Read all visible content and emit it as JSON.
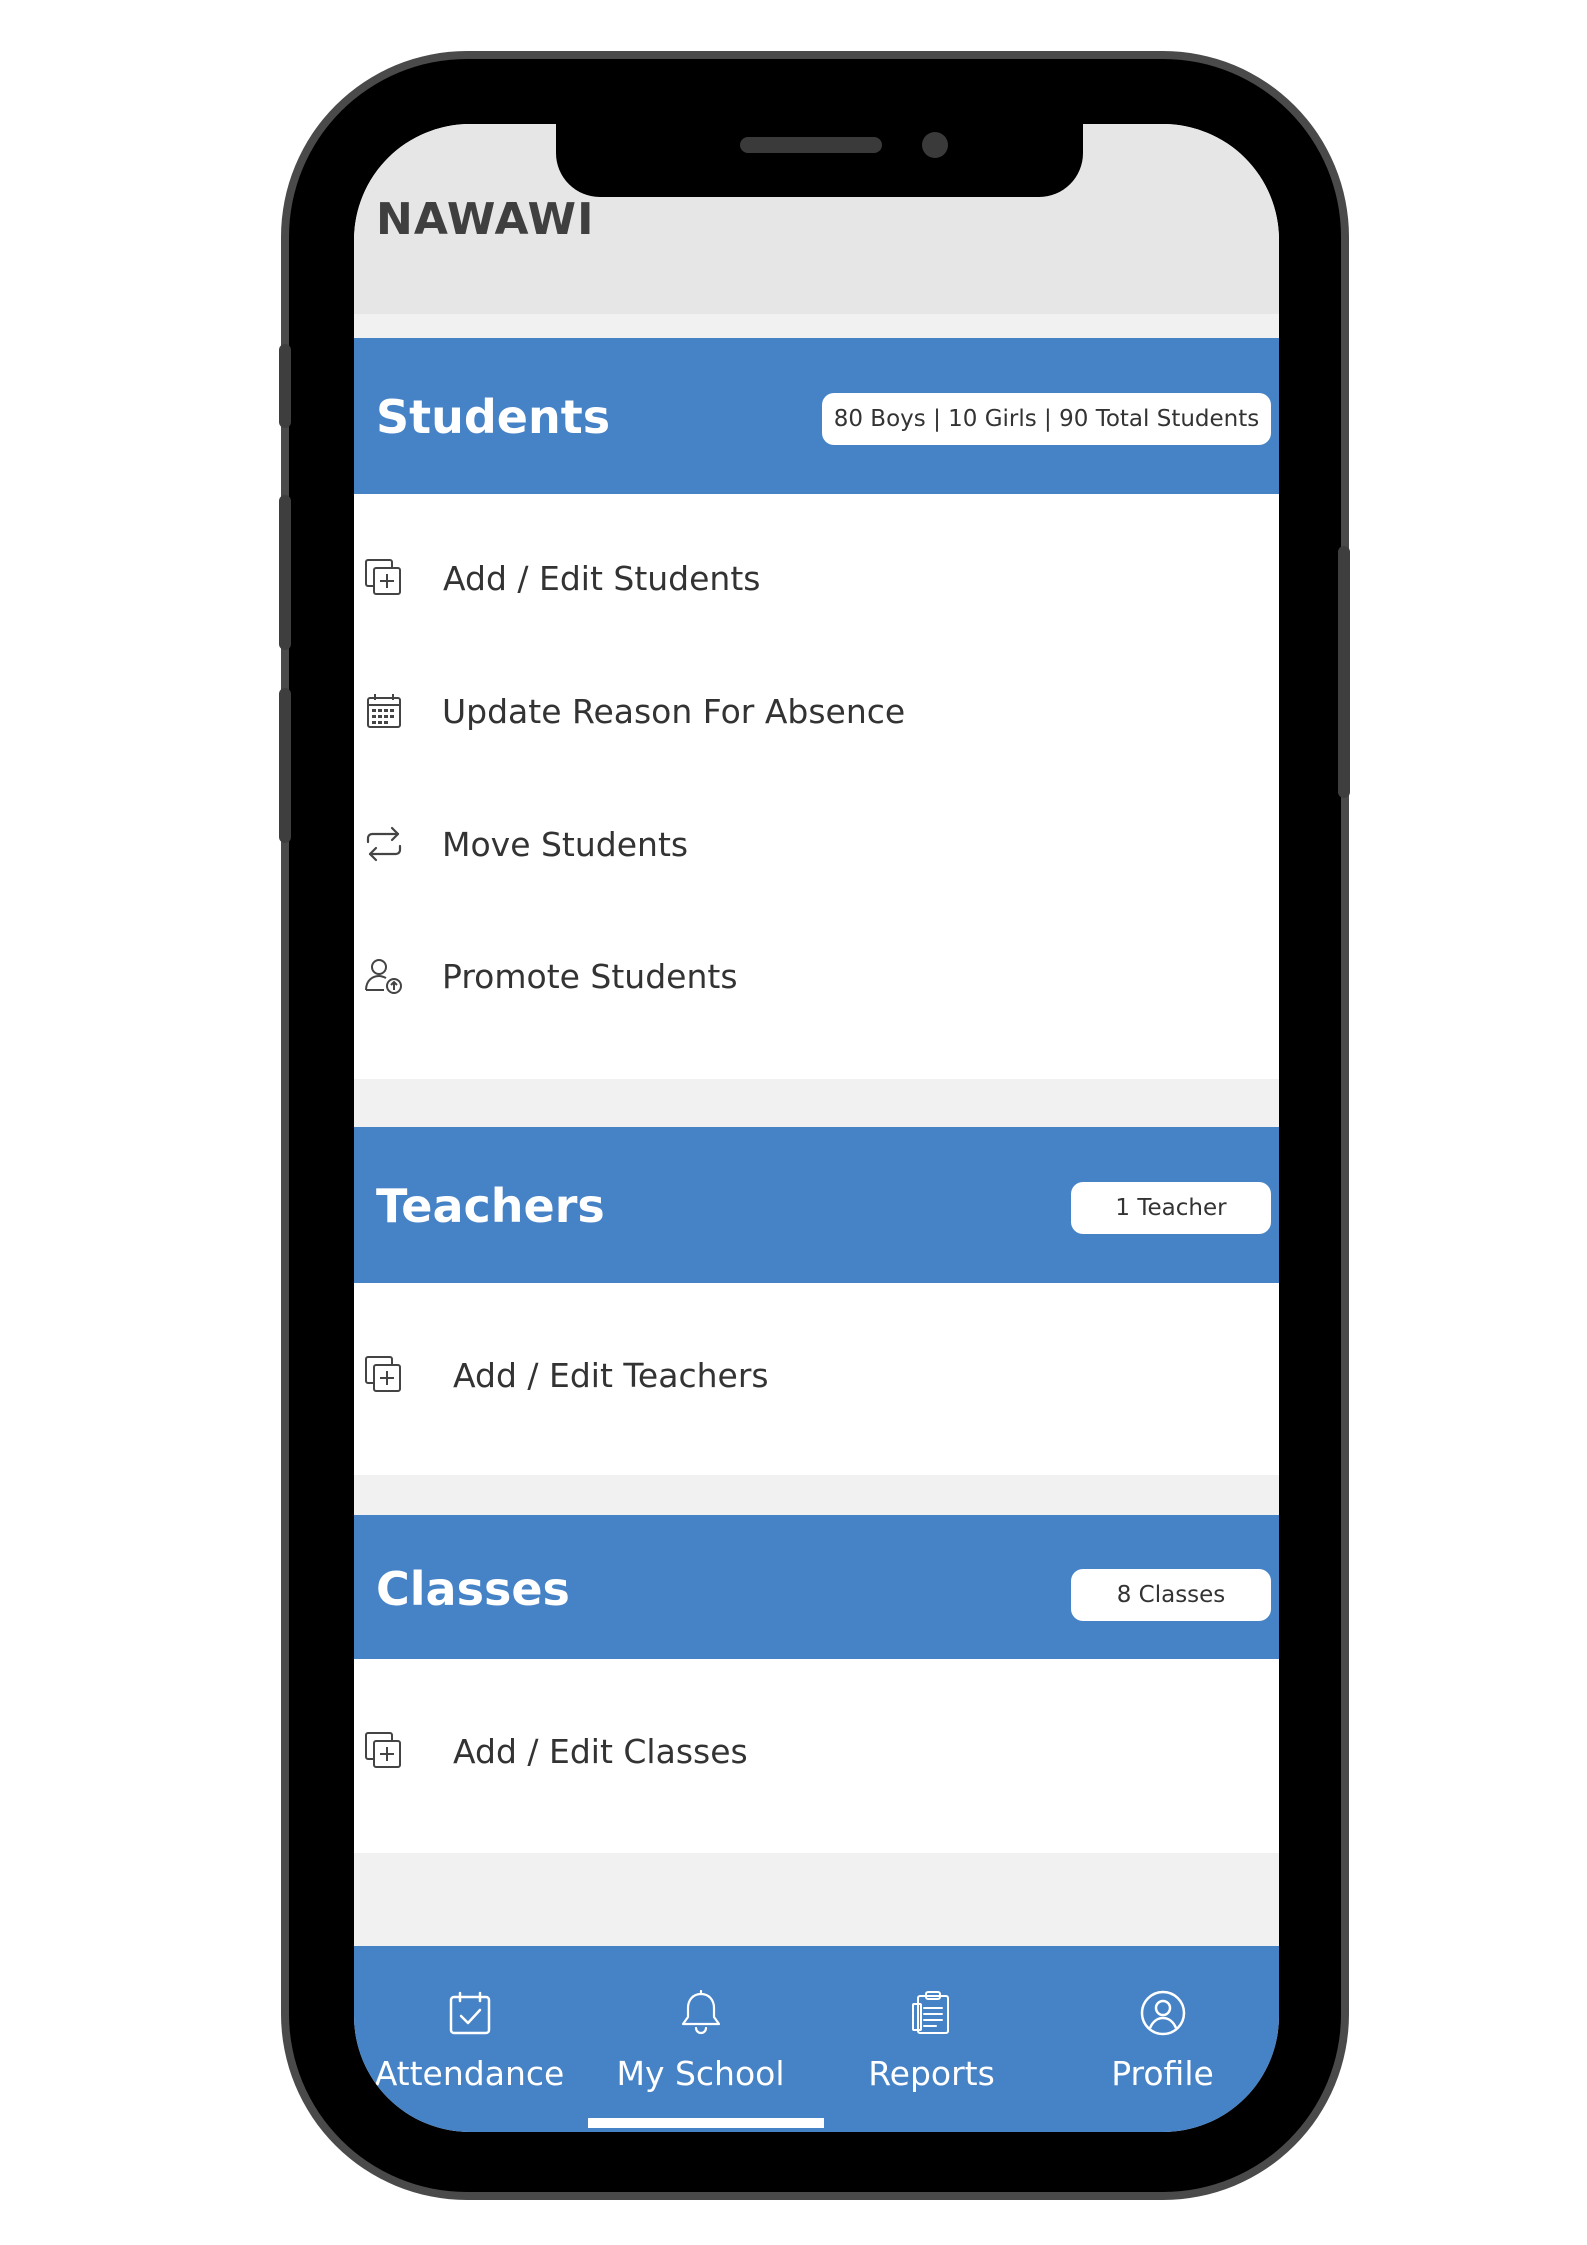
{
  "header": {
    "school_name": "NAWAWI"
  },
  "students": {
    "title": "Students",
    "badge": "80 Boys | 10 Girls | 90 Total Students",
    "items": [
      {
        "label": "Add / Edit Students",
        "icon": "add-copy-icon"
      },
      {
        "label": "Update Reason For Absence",
        "icon": "calendar-icon"
      },
      {
        "label": "Move Students",
        "icon": "swap-arrows-icon"
      },
      {
        "label": "Promote Students",
        "icon": "user-upload-icon"
      }
    ]
  },
  "teachers": {
    "title": "Teachers",
    "badge": "1 Teacher",
    "items": [
      {
        "label": "Add / Edit Teachers",
        "icon": "add-copy-icon"
      }
    ]
  },
  "classes": {
    "title": "Classes",
    "badge": "8 Classes",
    "items": [
      {
        "label": "Add / Edit Classes",
        "icon": "add-copy-icon"
      }
    ]
  },
  "nav": {
    "items": [
      {
        "label": "Attendance",
        "icon": "calendar-check-icon"
      },
      {
        "label": "My School",
        "icon": "bell-icon",
        "active": true
      },
      {
        "label": "Reports",
        "icon": "clipboard-icon"
      },
      {
        "label": "Profile",
        "icon": "user-circle-icon"
      }
    ]
  },
  "colors": {
    "accent": "#4682c6",
    "header_bg": "#e6e6e6",
    "frame": "#000000"
  }
}
